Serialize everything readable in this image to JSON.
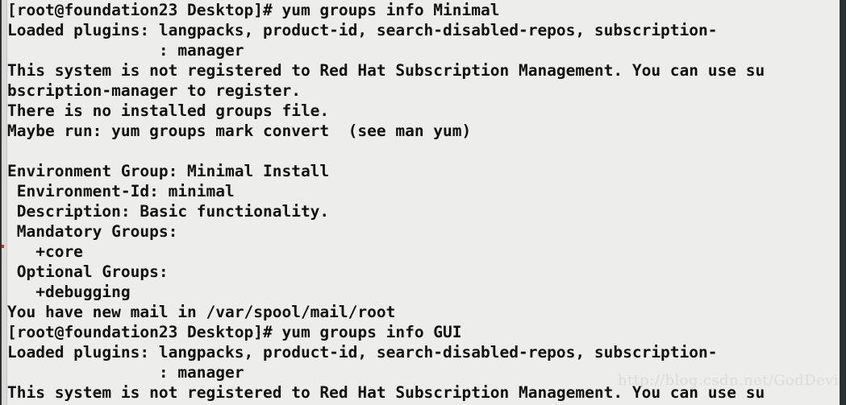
{
  "window": {
    "background_color": "#ededeb",
    "text_color": "#111111",
    "border_color": "#2b3133",
    "scrollbar_tick_color": "#c0392b"
  },
  "terminal": {
    "prompt": "[root@foundation23 Desktop]#",
    "lines": [
      "[root@foundation23 Desktop]# yum groups info Minimal",
      "Loaded plugins: langpacks, product-id, search-disabled-repos, subscription-",
      "                : manager",
      "This system is not registered to Red Hat Subscription Management. You can use su",
      "bscription-manager to register.",
      "There is no installed groups file.",
      "Maybe run: yum groups mark convert  (see man yum)",
      "",
      "Environment Group: Minimal Install",
      " Environment-Id: minimal",
      " Description: Basic functionality.",
      " Mandatory Groups:",
      "   +core",
      " Optional Groups:",
      "   +debugging",
      "You have new mail in /var/spool/mail/root",
      "[root@foundation23 Desktop]# yum groups info GUI",
      "Loaded plugins: langpacks, product-id, search-disabled-repos, subscription-",
      "                : manager",
      "This system is not registered to Red Hat Subscription Management. You can use su"
    ],
    "commands": [
      "yum groups info Minimal",
      "yum groups info GUI"
    ],
    "environment_group": {
      "name": "Minimal Install",
      "environment_id": "minimal",
      "description": "Basic functionality.",
      "mandatory_groups": [
        "+core"
      ],
      "optional_groups": [
        "+debugging"
      ]
    },
    "notices": [
      "There is no installed groups file.",
      "Maybe run: yum groups mark convert  (see man yum)",
      "You have new mail in /var/spool/mail/root"
    ],
    "plugins": [
      "langpacks",
      "product-id",
      "search-disabled-repos",
      "subscription-manager"
    ]
  },
  "watermark": {
    "text": "http://blog.csdn.net/GodDevin"
  }
}
